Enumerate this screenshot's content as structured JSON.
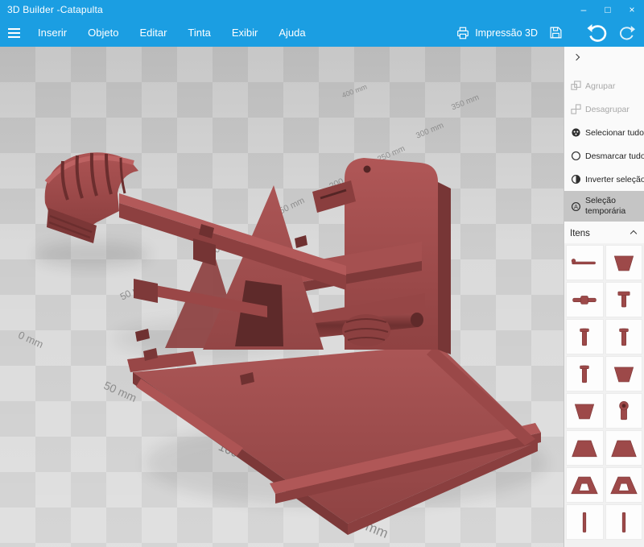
{
  "window": {
    "title": "3D Builder -Catapulta",
    "minimize": "–",
    "maximize": "□",
    "close": "×"
  },
  "menu": {
    "items": [
      "Inserir",
      "Objeto",
      "Editar",
      "Tinta",
      "Exibir",
      "Ajuda"
    ],
    "print_label": "Impressão 3D"
  },
  "viewport": {
    "ruler_labels": [
      "50 mm",
      "100 mm",
      "150 mm",
      "200 mm",
      "250 mm",
      "300 mm",
      "350 mm",
      "400 mm",
      "0 mm",
      "50 mm",
      "100 mm",
      "150 mm"
    ]
  },
  "panel": {
    "collapse_icon": "chevron-right",
    "buttons": [
      {
        "name": "group",
        "label": "Agrupar",
        "icon": "group-icon",
        "disabled": true
      },
      {
        "name": "ungroup",
        "label": "Desagrupar",
        "icon": "ungroup-icon",
        "disabled": true
      },
      {
        "name": "select-all",
        "label": "Selecionar tudo",
        "icon": "select-all-icon"
      },
      {
        "name": "deselect-all",
        "label": "Desmarcar tudo",
        "icon": "deselect-all-icon"
      },
      {
        "name": "invert-selection",
        "label": "Inverter seleção",
        "icon": "invert-selection-icon"
      },
      {
        "name": "temporary-selection",
        "label": "Seleção temporária",
        "icon": "temporary-selection-icon",
        "selected": true
      }
    ],
    "items_header": "Itens",
    "items": [
      "arm",
      "plate",
      "axle",
      "peg",
      "pin",
      "pin",
      "pin",
      "plate",
      "plate",
      "hole-bracket",
      "plate-wide",
      "plate-wide",
      "frame",
      "frame",
      "thin-pin",
      "thin-pin"
    ]
  },
  "colors": {
    "titlebar_blue": "#1b9ee2",
    "model_red": "#9d4949",
    "panel_selected_bg": "#c5c5c5"
  }
}
